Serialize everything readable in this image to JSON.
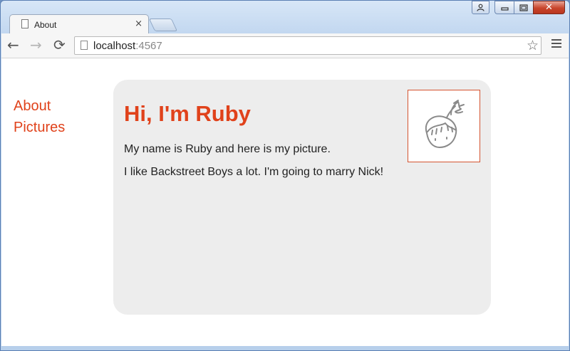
{
  "browser": {
    "tab": {
      "title": "About",
      "close": "×"
    },
    "toolbar": {
      "back": "←",
      "forward": "→",
      "reload": "⟳",
      "url_host": "localhost",
      "url_port": ":4567",
      "star": "☆"
    },
    "window_controls": {
      "user": "👤",
      "minimize": "▭",
      "maximize": "☐",
      "close": "✕"
    }
  },
  "page": {
    "nav": [
      {
        "label": "About"
      },
      {
        "label": "Pictures"
      }
    ],
    "card": {
      "heading": "Hi, I'm Ruby",
      "paragraphs": [
        "My name is Ruby and here is my picture.",
        "I like Backstreet Boys a lot. I'm going to marry Nick!"
      ],
      "image": "ruby-doodle"
    }
  },
  "colors": {
    "accent": "#e0421b",
    "card_bg": "#ededed",
    "photo_border": "#d4532f"
  }
}
